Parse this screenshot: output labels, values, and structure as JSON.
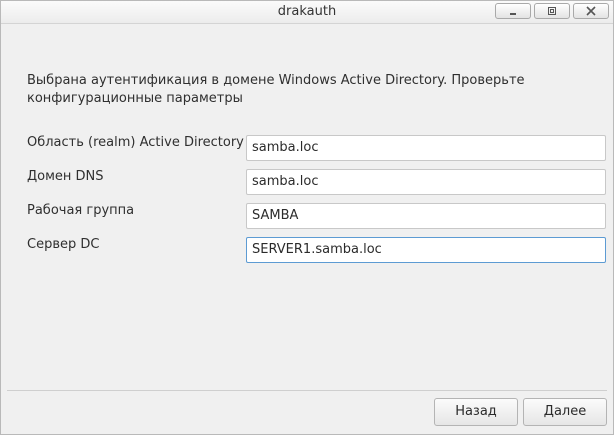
{
  "window": {
    "title": "drakauth",
    "controls": [
      "minimize-icon",
      "maximize-icon",
      "close-icon"
    ]
  },
  "intro": {
    "text": "Выбрана аутентификация в домене Windows Active Directory. Проверьте конфигурационные параметры"
  },
  "form": {
    "fields": [
      {
        "label": "Область (realm) Active Directory",
        "value": "samba.loc"
      },
      {
        "label": "Домен DNS",
        "value": "samba.loc"
      },
      {
        "label": "Рабочая группа",
        "value": "SAMBA"
      },
      {
        "label": "Сервер DC",
        "value": "SERVER1.samba.loc"
      }
    ]
  },
  "buttons": {
    "back_label": "Назад",
    "next_label": "Далее"
  },
  "colors": {
    "focus_border": "#5d9bd3",
    "window_bg": "#f0f0f0"
  }
}
